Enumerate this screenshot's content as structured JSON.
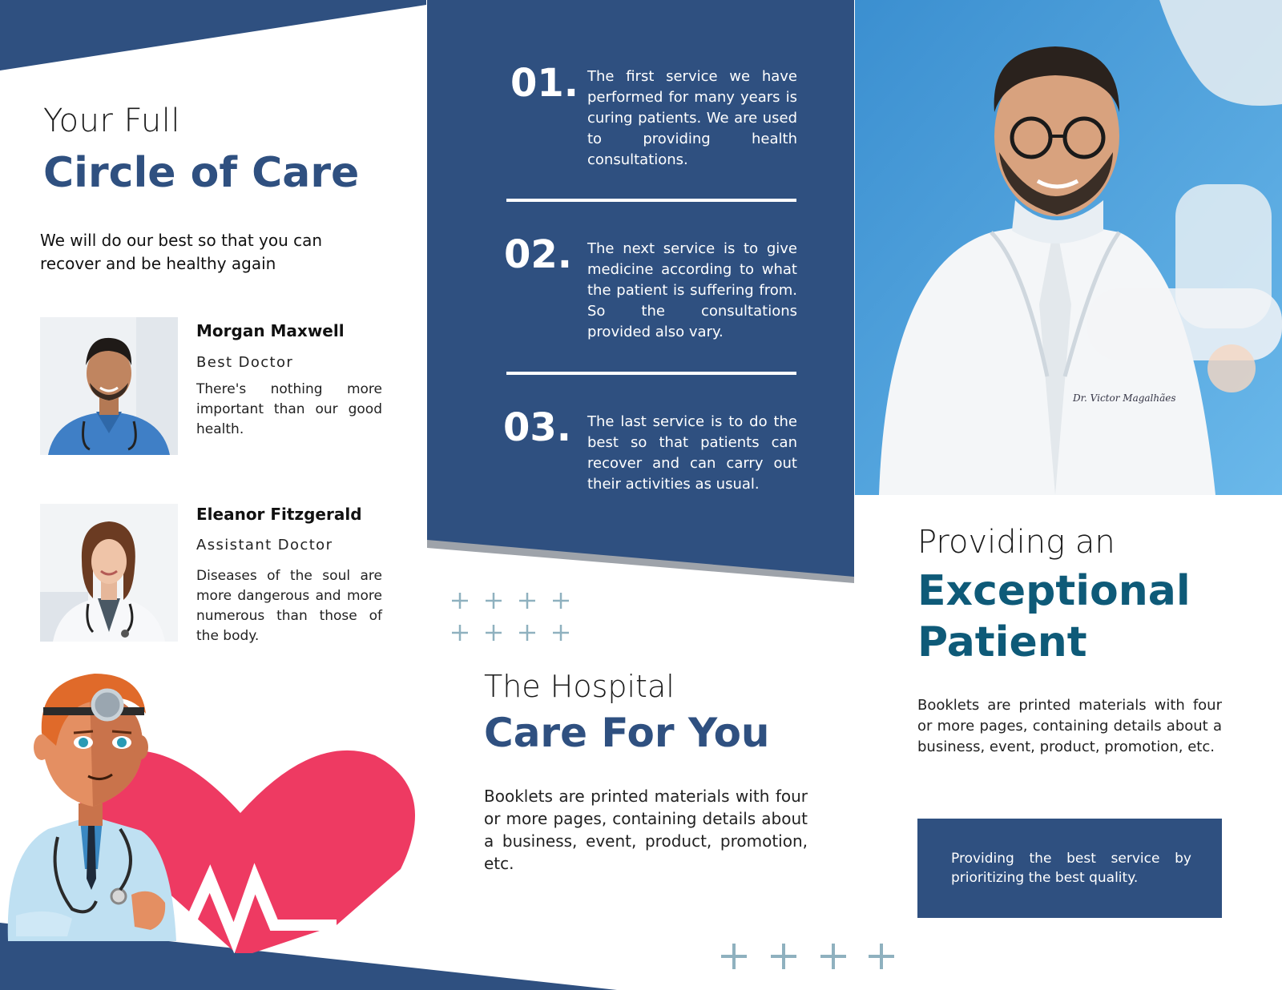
{
  "panel1": {
    "title_line1": "Your Full",
    "title_line2": "Circle of Care",
    "lead": "We will do our best so that you can recover and be healthy again",
    "doctors": [
      {
        "name": "Morgan Maxwell",
        "role": "Best Doctor",
        "description": "There's nothing more important than our good health."
      },
      {
        "name": "Eleanor Fitzgerald",
        "role": "Assistant Doctor",
        "description": "Diseases of the soul are more dangerous and more numerous than those of the body."
      }
    ]
  },
  "panel2": {
    "services": [
      {
        "number": "01.",
        "text": "The first service we have performed for many years is curing patients. We are used to providing health consultations."
      },
      {
        "number": "02.",
        "text": "The next service is to give medicine according to what the patient is suffering from. So the consultations provided also vary."
      },
      {
        "number": "03.",
        "text": "The last service is to do the best so that patients can recover and can carry out their activities as usual."
      }
    ],
    "title_line1": "The Hospital",
    "title_line2": "Care For You",
    "body": "Booklets are printed materials with four or more pages, containing details about a business, event, product, promotion, etc."
  },
  "panel3": {
    "coat_text": "Dr. Victor Magalhães",
    "title_line1": "Providing an",
    "title_line2": "Exceptional",
    "title_line3": "Patient",
    "body": "Booklets are printed materials with four or more pages, containing details about a business, event, product, promotion, etc.",
    "box_text": "Providing the best service by prioritizing the best quality."
  },
  "colors": {
    "navy": "#2f5080",
    "teal": "#0e5a78",
    "heart": "#ee3a62",
    "plus": "#8fb1bf",
    "photo_bg": "#4aa3df"
  }
}
